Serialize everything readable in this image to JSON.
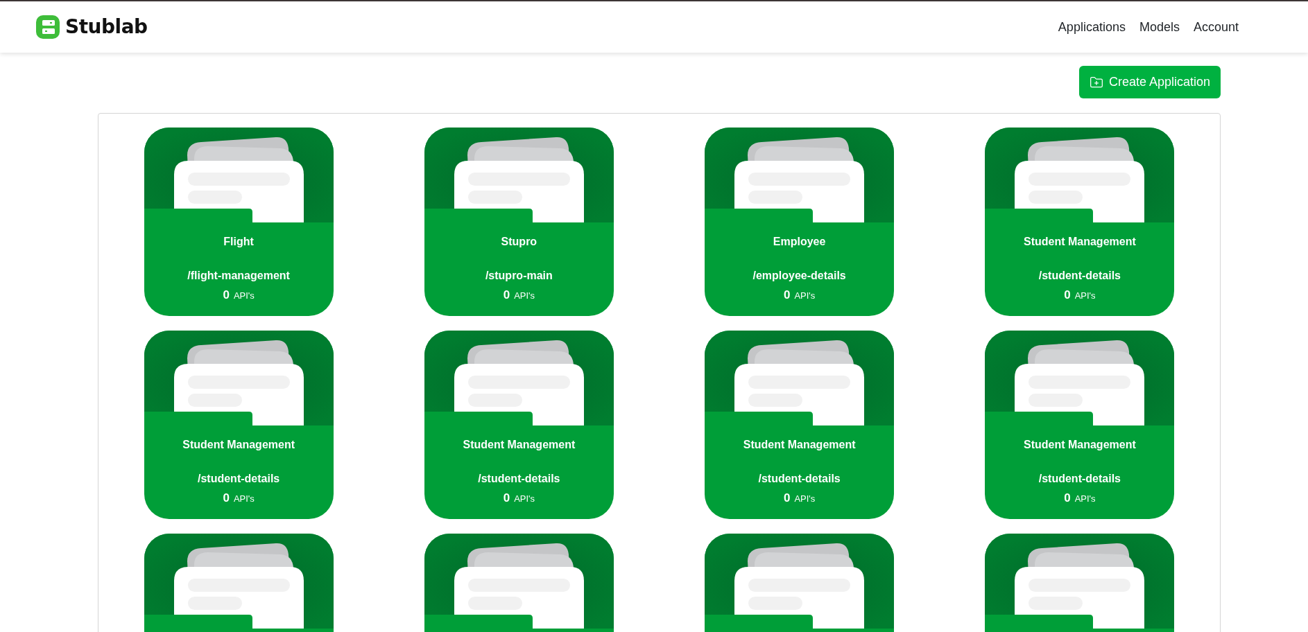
{
  "brand": {
    "name": "Stublab"
  },
  "nav": [
    {
      "label": "Applications"
    },
    {
      "label": "Models"
    },
    {
      "label": "Account"
    }
  ],
  "create_button": {
    "label": "Create Application"
  },
  "applications": [
    {
      "kind": "full",
      "name": "Flight",
      "path": "/flight-management",
      "count": "0",
      "unit": "API's"
    },
    {
      "kind": "full",
      "name": "Stupro",
      "path": "/stupro-main",
      "count": "0",
      "unit": "API's"
    },
    {
      "kind": "full",
      "name": "Employee",
      "path": "/employee-details",
      "count": "0",
      "unit": "API's"
    },
    {
      "kind": "full",
      "name": "Student Management",
      "path": "/student-details",
      "count": "0",
      "unit": "API's"
    },
    {
      "kind": "full",
      "name": "Student Management",
      "path": "/student-details",
      "count": "0",
      "unit": "API's"
    },
    {
      "kind": "full",
      "name": "Student Management",
      "path": "/student-details",
      "count": "0",
      "unit": "API's"
    },
    {
      "kind": "full",
      "name": "Student Management",
      "path": "/student-details",
      "count": "0",
      "unit": "API's"
    },
    {
      "kind": "full",
      "name": "Student Management",
      "path": "/student-details",
      "count": "0",
      "unit": "API's"
    },
    {
      "kind": "partial"
    },
    {
      "kind": "partial"
    },
    {
      "kind": "partial"
    },
    {
      "kind": "partial"
    }
  ]
}
